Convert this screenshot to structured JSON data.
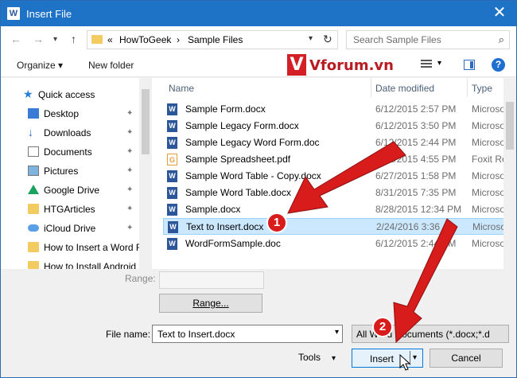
{
  "window": {
    "title": "Insert File",
    "app_icon": "W",
    "close_glyph": "✕"
  },
  "address_bar": {
    "back_glyph": "←",
    "forward_glyph": "→",
    "up_glyph": "↑",
    "overflow": "«",
    "crumbs": [
      "HowToGeek",
      "Sample Files"
    ],
    "separator": "›",
    "refresh_glyph": "↻",
    "search_placeholder": "Search Sample Files"
  },
  "toolbar": {
    "organize_label": "Organize ▾",
    "new_folder_label": "New folder",
    "watermark_letter": "V",
    "watermark_text": "Vforum.vn",
    "help_label": "?"
  },
  "nav": {
    "items": [
      {
        "label": "Quick access",
        "icon": "star-icon",
        "pinned": false
      },
      {
        "label": "Desktop",
        "icon": "desktop-icon",
        "pinned": true
      },
      {
        "label": "Downloads",
        "icon": "download-icon",
        "pinned": true
      },
      {
        "label": "Documents",
        "icon": "documents-icon",
        "pinned": true
      },
      {
        "label": "Pictures",
        "icon": "pictures-icon",
        "pinned": true
      },
      {
        "label": "Google Drive",
        "icon": "google-drive-icon",
        "pinned": true
      },
      {
        "label": "HTGArticles",
        "icon": "folder-icon",
        "pinned": true
      },
      {
        "label": "iCloud Drive",
        "icon": "icloud-icon",
        "pinned": true
      },
      {
        "label": "How to Insert a Word F",
        "icon": "folder-icon",
        "pinned": false
      },
      {
        "label": "How to Install Android",
        "icon": "folder-icon",
        "pinned": false
      }
    ],
    "pin_glyph": "📌"
  },
  "files": {
    "columns": {
      "name": "Name",
      "date": "Date modified",
      "type": "Type"
    },
    "rows": [
      {
        "name": "Sample Form.docx",
        "date": "6/12/2015 2:57 PM",
        "type": "Microso",
        "icon": "W"
      },
      {
        "name": "Sample Legacy Form.docx",
        "date": "6/12/2015 3:50 PM",
        "type": "Microso",
        "icon": "W"
      },
      {
        "name": "Sample Legacy Word Form.doc",
        "date": "6/12/2015 2:44 PM",
        "type": "Microso",
        "icon": "W"
      },
      {
        "name": "Sample Spreadsheet.pdf",
        "date": "6/12/2015 4:55 PM",
        "type": "Foxit Re",
        "icon": "G"
      },
      {
        "name": "Sample Word Table - Copy.docx",
        "date": "6/27/2015 1:58 PM",
        "type": "Microso",
        "icon": "W"
      },
      {
        "name": "Sample Word Table.docx",
        "date": "8/31/2015 7:35 PM",
        "type": "Microso",
        "icon": "W"
      },
      {
        "name": "Sample.docx",
        "date": "8/28/2015 12:34 PM",
        "type": "Microso",
        "icon": "W"
      },
      {
        "name": "Text to Insert.docx",
        "date": "2/24/2016 3:36",
        "type": "Microso",
        "icon": "W",
        "selected": true
      },
      {
        "name": "WordFormSample.doc",
        "date": "6/12/2015 2:44 PM",
        "type": "Microso",
        "icon": "W"
      }
    ]
  },
  "range": {
    "label": "Range:",
    "button_label": "Range..."
  },
  "file_name": {
    "label": "File name:",
    "value": "Text to Insert.docx"
  },
  "file_type": {
    "value": "All Word Documents (*.docx;*.d"
  },
  "buttons": {
    "tools": "Tools",
    "insert": "Insert",
    "cancel": "Cancel",
    "chevron": "▾"
  },
  "annotations": {
    "step1": "1",
    "step2": "2"
  },
  "colors": {
    "titlebar": "#1f73c6",
    "selection": "#cce8ff",
    "arrow": "#d81b1b"
  }
}
